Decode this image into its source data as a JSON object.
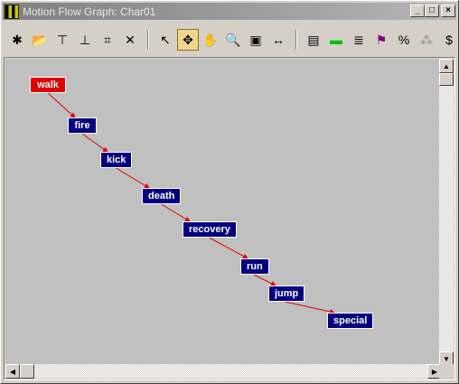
{
  "window": {
    "title": "Motion Flow Graph: Char01"
  },
  "title_buttons": {
    "minimize": "_",
    "maximize": "□",
    "close": "×"
  },
  "toolbar": {
    "left_group": [
      {
        "name": "create-motion-icon",
        "glyph": "✱"
      },
      {
        "name": "load-files-icon",
        "glyph": "📂"
      },
      {
        "name": "insert-above-icon",
        "glyph": "⊤"
      },
      {
        "name": "insert-below-icon",
        "glyph": "⊥"
      },
      {
        "name": "create-transition-icon",
        "glyph": "⌗"
      },
      {
        "name": "delete-icon",
        "glyph": "✕"
      }
    ],
    "nav_group": [
      {
        "name": "select-icon",
        "glyph": "↖"
      },
      {
        "name": "move-icon",
        "glyph": "✥"
      },
      {
        "name": "pan-hand-icon",
        "glyph": "✋"
      },
      {
        "name": "zoom-icon",
        "glyph": "🔍"
      },
      {
        "name": "zoom-region-icon",
        "glyph": "▣"
      },
      {
        "name": "zoom-extents-icon",
        "glyph": "↔"
      }
    ],
    "right_group": [
      {
        "name": "clip-icon",
        "glyph": "▤"
      },
      {
        "name": "green-bar-icon",
        "glyph": "▬"
      },
      {
        "name": "script-icon",
        "glyph": "≣"
      },
      {
        "name": "select-flag-icon",
        "glyph": "⚑"
      },
      {
        "name": "percent-icon",
        "glyph": "%"
      },
      {
        "name": "random-icon",
        "glyph": "⁂"
      },
      {
        "name": "dollar-icon",
        "glyph": "$"
      }
    ],
    "active_tool": "move-icon"
  },
  "graph": {
    "nodes": [
      {
        "id": "walk",
        "label": "walk",
        "selected": true
      },
      {
        "id": "fire",
        "label": "fire",
        "selected": false
      },
      {
        "id": "kick",
        "label": "kick",
        "selected": false
      },
      {
        "id": "death",
        "label": "death",
        "selected": false
      },
      {
        "id": "recovery",
        "label": "recovery",
        "selected": false
      },
      {
        "id": "run",
        "label": "run",
        "selected": false
      },
      {
        "id": "jump",
        "label": "jump",
        "selected": false
      },
      {
        "id": "special",
        "label": "special",
        "selected": false
      }
    ],
    "edges": [
      [
        "walk",
        "fire"
      ],
      [
        "fire",
        "kick"
      ],
      [
        "kick",
        "death"
      ],
      [
        "death",
        "recovery"
      ],
      [
        "recovery",
        "run"
      ],
      [
        "run",
        "jump"
      ],
      [
        "jump",
        "special"
      ]
    ]
  },
  "colors": {
    "node": "#000080",
    "selected_node": "#e00000",
    "edge": "#e00000",
    "canvas": "#c0c0c0"
  },
  "scrollbars": {
    "up": "▲",
    "down": "▼",
    "left": "◀",
    "right": "▶"
  }
}
